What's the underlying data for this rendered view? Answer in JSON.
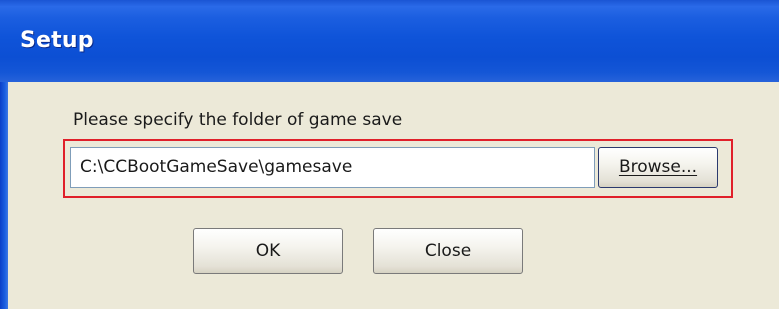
{
  "window": {
    "title": "Setup"
  },
  "dialog": {
    "prompt": "Please specify the folder of game save",
    "path_value": "C:\\CCBootGameSave\\gamesave",
    "browse_label": "Browse...",
    "ok_label": "OK",
    "close_label": "Close"
  },
  "colors": {
    "titlebar": "#0c4fd4",
    "client": "#ece9d8",
    "highlight": "#e0202a"
  }
}
